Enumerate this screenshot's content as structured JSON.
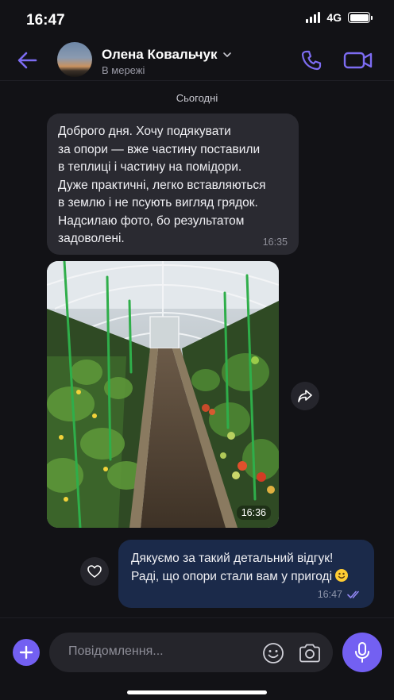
{
  "status_bar": {
    "time": "16:47",
    "network": "4G",
    "icons": [
      "signal-icon",
      "battery-icon"
    ]
  },
  "header": {
    "contact_name": "Олена Ковальчук",
    "status": "В мережі",
    "icons": [
      "back-arrow-icon",
      "chevron-down-icon",
      "phone-icon",
      "video-camera-icon"
    ]
  },
  "date_separator": "Сьогодні",
  "messages": [
    {
      "direction": "incoming",
      "type": "text",
      "text": "Доброго дня. Хочу подякувати\nза опори — вже частину поставили\nв теплиці і частину на помідори.\nДуже практичні, легко вставляються\nв землю і не псують вигляд грядок.\nНадсилаю фото, бо результатом\nзадоволені.",
      "time": "16:35"
    },
    {
      "direction": "incoming",
      "type": "photo",
      "time": "16:36",
      "icons": [
        "greenhouse-photo",
        "share-icon"
      ]
    },
    {
      "direction": "outgoing",
      "type": "text",
      "text": "Дякуємо за такий детальний відгук!\nРаді, що опори стали вам у пригоді",
      "time": "16:47",
      "icons": [
        "smile-emoji-icon",
        "double-check-icon",
        "heart-icon"
      ]
    }
  ],
  "composer": {
    "placeholder": "Повідомлення...",
    "icons": [
      "plus-icon",
      "sticker-icon",
      "camera-icon",
      "microphone-icon"
    ]
  },
  "colors": {
    "background": "#121216",
    "accent": "#7360f2",
    "incoming_bubble": "#2a2a31",
    "outgoing_bubble": "#1b2a4a"
  }
}
